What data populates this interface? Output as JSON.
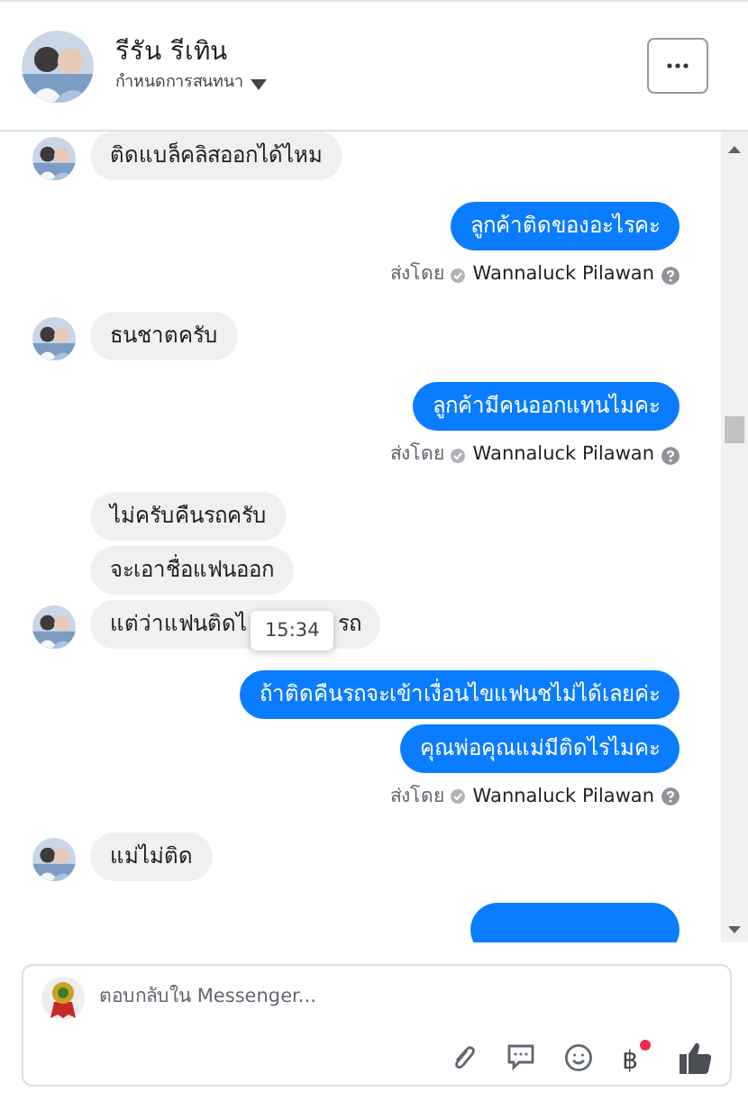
{
  "header": {
    "name": "รีรัน รีเทิน",
    "subtitle": "กำหนดการสนทนา"
  },
  "messages": [
    {
      "kind": "incoming",
      "text": "ติดแบล็คลิสออกได้ไหม"
    },
    {
      "kind": "outgoing",
      "text": "ลูกค้าติดของอะไรคะ",
      "sent_by": {
        "label": "ส่งโดย",
        "name": "Wannaluck Pilawan"
      }
    },
    {
      "kind": "incoming",
      "text": "ธนชาตครับ"
    },
    {
      "kind": "outgoing",
      "text": "ลูกค้ามีคนออกแทนไมคะ",
      "sent_by": {
        "label": "ส่งโดย",
        "name": "Wannaluck Pilawan"
      }
    },
    {
      "kind": "incoming",
      "text": "ไม่ครับคืนรถครับ"
    },
    {
      "kind": "incoming",
      "text": "จะเอาชื่อแฟนออก"
    },
    {
      "kind": "incoming",
      "text_parts": [
        "แต่ว่าแฟนติดไ",
        "รถ"
      ],
      "tooltip": "15:34"
    },
    {
      "kind": "outgoing",
      "text": "ถ้าติดคืนรถจะเข้าเงื่อนไขแฟนชไม่ได้เลยค่ะ"
    },
    {
      "kind": "outgoing",
      "text": "คุณพ่อคุณแม่มีติดไรไมคะ",
      "sent_by": {
        "label": "ส่งโดย",
        "name": "Wannaluck Pilawan"
      }
    },
    {
      "kind": "incoming",
      "text": "แม่ไม่ติด"
    },
    {
      "kind": "outgoing"
    }
  ],
  "composer": {
    "placeholder": "ตอบกลับใน Messenger...",
    "currency_symbol": "฿",
    "currency_badge": true
  }
}
